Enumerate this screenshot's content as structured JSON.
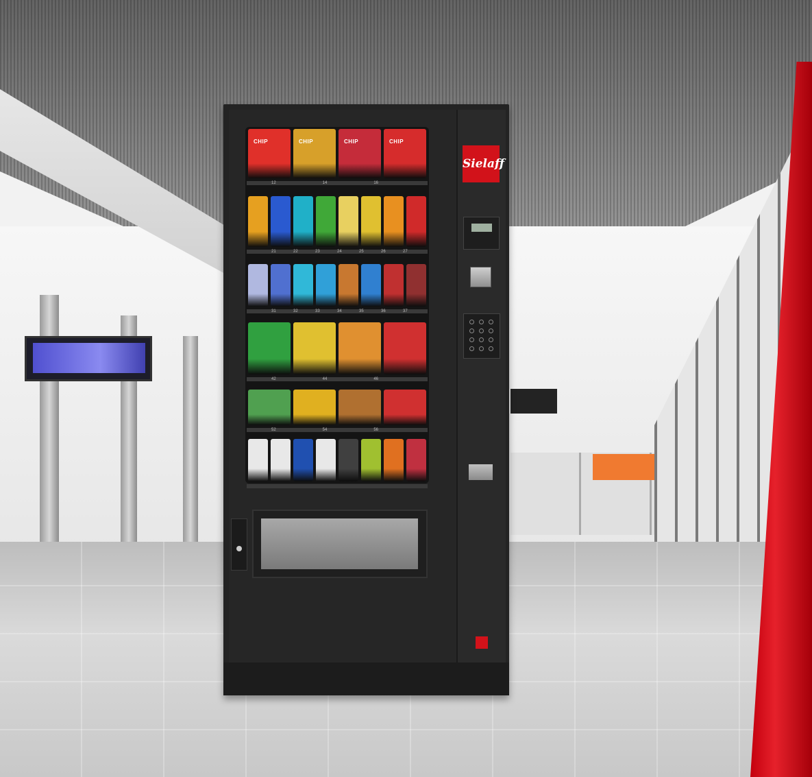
{
  "brand": {
    "name": "Sielaff",
    "accent": "#d2121a"
  },
  "products": {
    "row1_label": "CHIP",
    "row1_colors": [
      "#e0302a",
      "#d7a02a",
      "#c52c3a",
      "#d62c2c"
    ],
    "row2_colors": [
      "#e6a020",
      "#2a5ad0",
      "#20b0c8",
      "#40a838",
      "#e8d060",
      "#e0c030",
      "#e89020",
      "#d02a2a"
    ],
    "row3_colors": [
      "#b0b8e0",
      "#5070d0",
      "#30b8d8",
      "#30a0d8",
      "#c87830",
      "#3080d0",
      "#c03030",
      "#903030"
    ],
    "row4_colors": [
      "#30a040",
      "#e0c030",
      "#e09030",
      "#d03030"
    ],
    "row5_colors": [
      "#50a050",
      "#e0b020",
      "#b07030",
      "#d03030"
    ],
    "row6_colors": [
      "#e8e8e8",
      "#e8e8e8",
      "#2050b0",
      "#e8e8e8",
      "#404040",
      "#a0c030",
      "#e07020",
      "#c03040"
    ]
  },
  "shelf_tags": {
    "row1": [
      "12",
      "14",
      "16"
    ],
    "row2": [
      "21",
      "22",
      "23",
      "24",
      "25",
      "26",
      "27"
    ],
    "row3": [
      "31",
      "32",
      "33",
      "34",
      "35",
      "36",
      "37"
    ],
    "row4": [
      "42",
      "44",
      "46"
    ],
    "row5": [
      "52",
      "54",
      "56"
    ]
  }
}
